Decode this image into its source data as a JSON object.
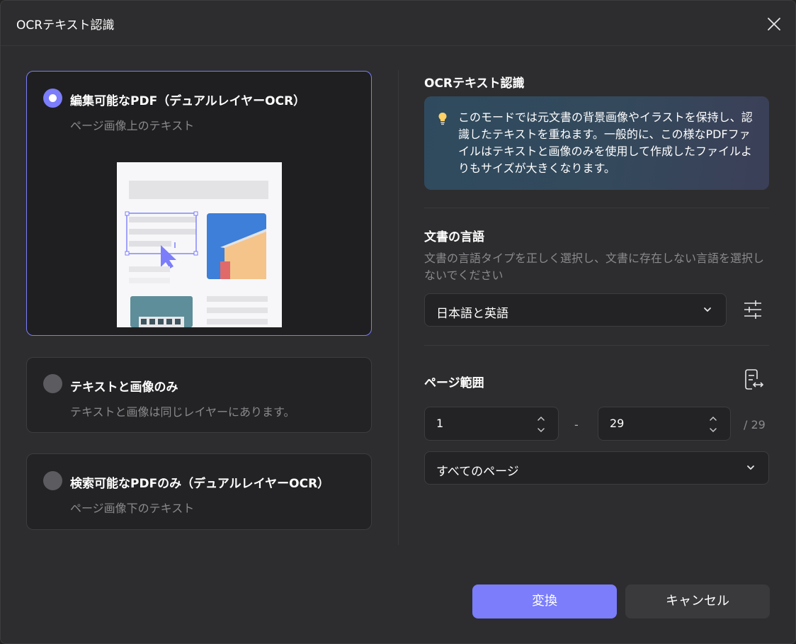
{
  "dialog": {
    "title": "OCRテキスト認識",
    "close_icon": "close-icon"
  },
  "options": [
    {
      "title": "編集可能なPDF（デュアルレイヤーOCR）",
      "subtitle": "ページ画像上のテキスト",
      "selected": true
    },
    {
      "title": "テキストと画像のみ",
      "subtitle": "テキストと画像は同じレイヤーにあります。",
      "selected": false
    },
    {
      "title": "検索可能なPDFのみ（デュアルレイヤーOCR）",
      "subtitle": "ページ画像下のテキスト",
      "selected": false
    }
  ],
  "right": {
    "ocr_heading": "OCRテキスト認識",
    "info_icon": "lightbulb-icon",
    "info_text": "このモードでは元文書の背景画像やイラストを保持し、認識したテキストを重ねます。一般的に、この様なPDFファイルはテキストと画像のみを使用して作成したファイルよりもサイズが大きくなります。",
    "language_heading": "文書の言語",
    "language_help": "文書の言語タイプを正しく選択し、文書に存在しない言語を選択しないでください",
    "language_value": "日本語と英語",
    "language_settings_icon": "sliders-icon",
    "range_heading": "ページ範囲",
    "range_icon": "page-range-icon",
    "range_from": "1",
    "range_dash": "-",
    "range_to": "29",
    "range_total": "/ 29",
    "range_preset": "すべてのページ"
  },
  "buttons": {
    "convert": "変換",
    "cancel": "キャンセル"
  },
  "colors": {
    "accent": "#7b7dfa",
    "background": "#2d2d2f",
    "card": "#232325"
  }
}
